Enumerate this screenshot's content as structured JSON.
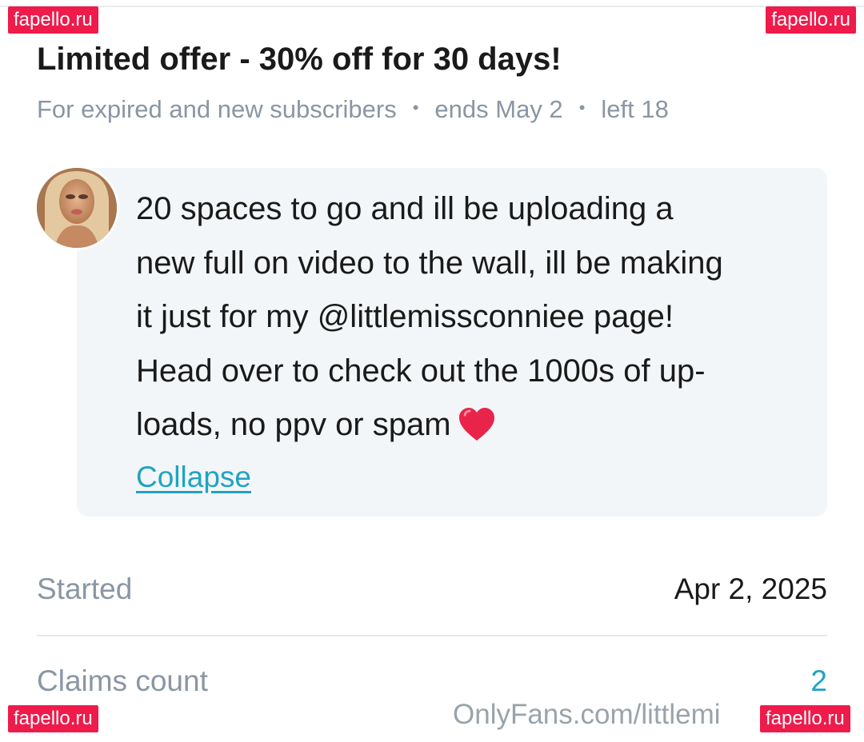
{
  "watermark": {
    "text": "fapello.ru",
    "color": "#ee1b4b"
  },
  "offer": {
    "title": "Limited offer - 30% off for 30 days!",
    "audience": "For expired and new subscribers",
    "separator": "•",
    "ends": "ends May 2",
    "left": "left 18"
  },
  "message": {
    "avatar_icon": "user-avatar",
    "line1": "20 spaces to go and ill be uploading a",
    "line2": "new full on video to the wall, ill be making",
    "line3": "it just for my @littlemissconniee page!",
    "line4": "Head over to check out the 1000s of up-",
    "line5": "loads, no ppv or spam",
    "emoji_icon": "red-heart-icon",
    "collapse_label": "Collapse",
    "link_color": "#1fa3c4"
  },
  "details": {
    "started_label": "Started",
    "started_value": "Apr 2, 2025",
    "claims_label": "Claims count",
    "claims_value": "2"
  },
  "footer": {
    "url": "OnlyFans.com/littlemi"
  }
}
